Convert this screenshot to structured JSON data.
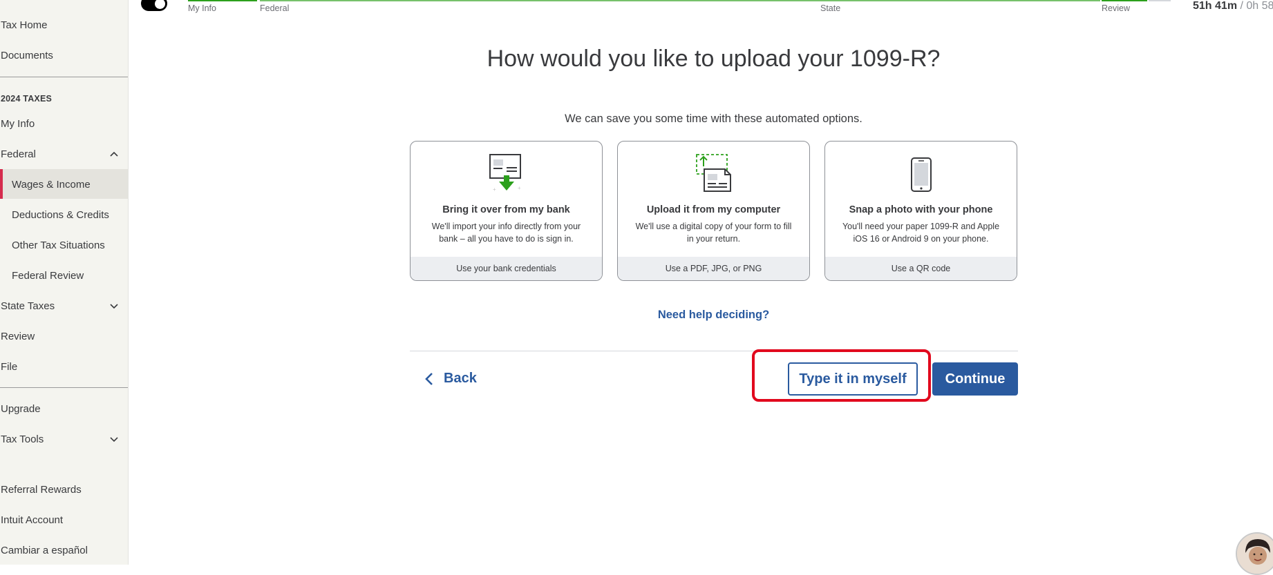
{
  "sidebar": {
    "tax_home": "Tax Home",
    "documents": "Documents",
    "section_title": "2024 TAXES",
    "my_info": "My Info",
    "federal": "Federal",
    "federal_children": [
      "Wages & Income",
      "Deductions & Credits",
      "Other Tax Situations",
      "Federal Review"
    ],
    "state_taxes": "State Taxes",
    "review": "Review",
    "file": "File",
    "upgrade": "Upgrade",
    "tax_tools": "Tax Tools",
    "referral": "Referral Rewards",
    "account": "Intuit Account",
    "language": "Cambiar a español",
    "active_color": "#d52b4d"
  },
  "progress": {
    "steps": [
      "My Info",
      "Federal",
      "State",
      "Review"
    ],
    "accent": "#2ca01c"
  },
  "timer": {
    "elapsed": "51h 41m",
    "rest": "/ 0h 58"
  },
  "main": {
    "heading": "How would you like to upload your 1099-R?",
    "subheading": "We can save you some time with these automated options.",
    "cards": [
      {
        "title": "Bring it over from my bank",
        "desc": "We'll import your info directly from your bank – all you have to do is sign in.",
        "footer": "Use your bank credentials",
        "icon": "bank-import-icon"
      },
      {
        "title": "Upload it from my computer",
        "desc": "We'll use a digital copy of your form to fill in your return.",
        "footer": "Use a PDF, JPG, or PNG",
        "icon": "computer-upload-icon"
      },
      {
        "title": "Snap a photo with your phone",
        "desc": "You'll need your paper 1099-R and Apple iOS 16 or Android 9 on your phone.",
        "footer": "Use a QR code",
        "icon": "phone-icon"
      }
    ],
    "help_link": "Need help deciding?",
    "back": "Back",
    "type_it": "Type it in myself",
    "continue": "Continue",
    "brand_blue": "#2a5a9f",
    "highlight_color": "#e1081d"
  }
}
